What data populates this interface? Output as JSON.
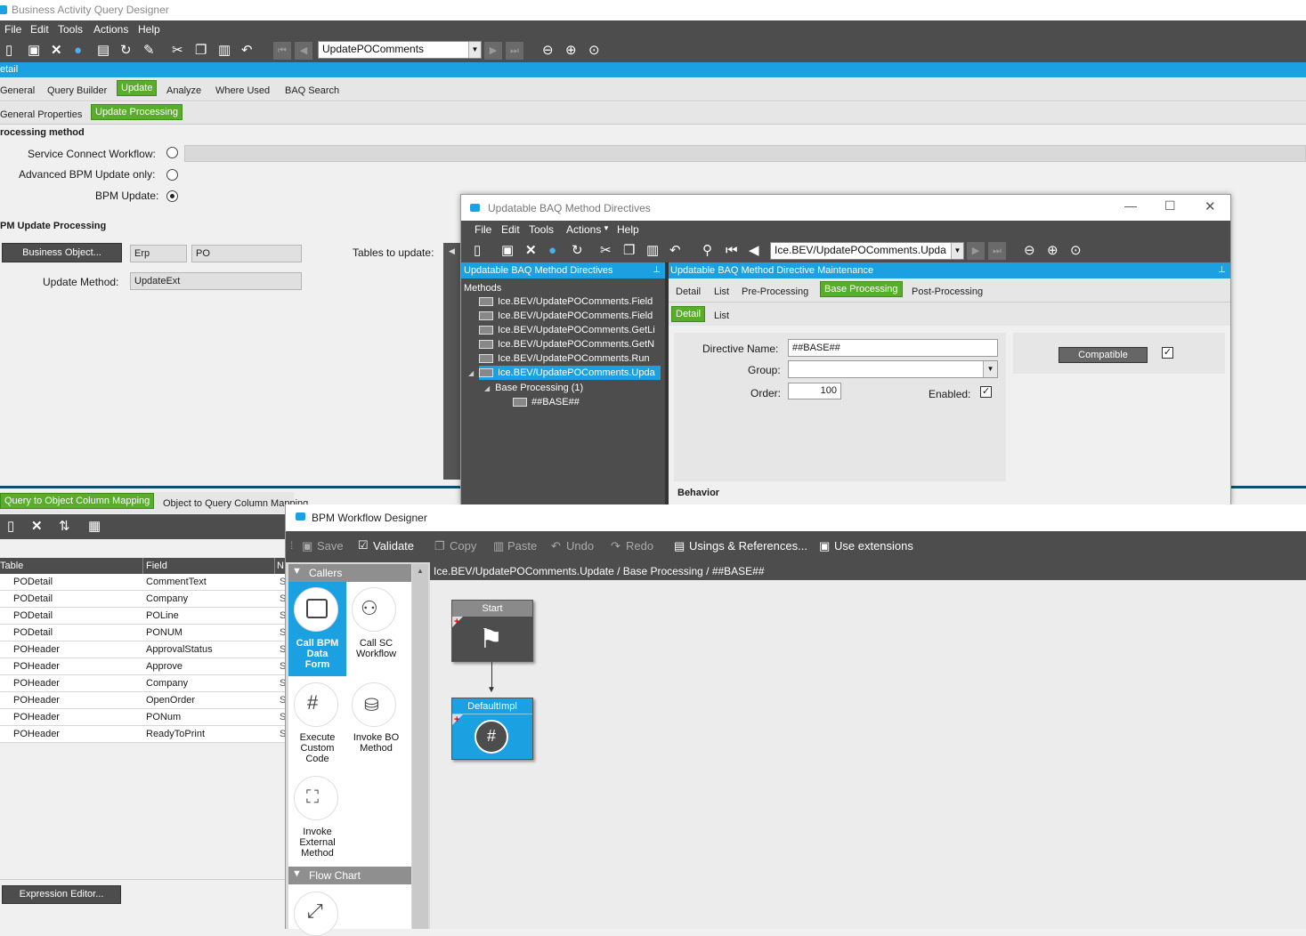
{
  "main": {
    "title": "Business Activity Query Designer",
    "menu": [
      "File",
      "Edit",
      "Tools",
      "Actions",
      "Help"
    ],
    "query_id": "UpdatePOComments",
    "detail_bar": "etail",
    "tabs1": [
      "General",
      "Query Builder",
      "Update",
      "Analyze",
      "Where Used",
      "BAQ Search"
    ],
    "tabs2": [
      "General Properties",
      "Update Processing"
    ],
    "processing_method": "rocessing method",
    "options": [
      "Service Connect Workflow:",
      "Advanced BPM Update only:",
      "BPM Update:"
    ],
    "bpm_section": "PM Update Processing",
    "business_object_btn": "Business Object...",
    "bo_fields": [
      "Erp",
      "PO"
    ],
    "tables_to_update": "Tables to update:",
    "update_method_label": "Update Method:",
    "update_method_value": "UpdateExt",
    "map_tabs": [
      "Query to Object Column Mapping",
      "Object to Query Column Mapping"
    ],
    "grid_headers": [
      "Table",
      "Field",
      "N"
    ],
    "grid_rows": [
      [
        "PODetail",
        "CommentText"
      ],
      [
        "PODetail",
        "Company"
      ],
      [
        "PODetail",
        "POLine"
      ],
      [
        "PODetail",
        "PONUM"
      ],
      [
        "POHeader",
        "ApprovalStatus"
      ],
      [
        "POHeader",
        "Approve"
      ],
      [
        "POHeader",
        "Company"
      ],
      [
        "POHeader",
        "OpenOrder"
      ],
      [
        "POHeader",
        "PONum"
      ],
      [
        "POHeader",
        "ReadyToPrint"
      ]
    ],
    "expression_editor": "Expression Editor..."
  },
  "directives": {
    "title": "Updatable BAQ Method Directives",
    "menu": [
      "File",
      "Edit",
      "Tools",
      "Actions",
      "Help"
    ],
    "combo": "Ice.BEV/UpdatePOComments.Upda",
    "left_header": "Updatable BAQ Method Directives",
    "right_header": "Updatable BAQ Method Directive Maintenance",
    "methods_label": "Methods",
    "methods": [
      "Ice.BEV/UpdatePOComments.Field",
      "Ice.BEV/UpdatePOComments.Field",
      "Ice.BEV/UpdatePOComments.GetLi",
      "Ice.BEV/UpdatePOComments.GetN",
      "Ice.BEV/UpdatePOComments.Run",
      "Ice.BEV/UpdatePOComments.Upda"
    ],
    "base_processing_node": "Base Processing (1)",
    "base_leaf": "##BASE##",
    "tabs": [
      "Detail",
      "List",
      "Pre-Processing",
      "Base Processing",
      "Post-Processing"
    ],
    "subtabs": [
      "Detail",
      "List"
    ],
    "directive_name_label": "Directive Name:",
    "directive_name": "##BASE##",
    "group_label": "Group:",
    "group_value": "",
    "order_label": "Order:",
    "order_value": "100",
    "enabled_label": "Enabled:",
    "compatible_btn": "Compatible",
    "behavior_label": "Behavior"
  },
  "workflow": {
    "title": "BPM Workflow Designer",
    "toolbar": [
      "Save",
      "Validate",
      "Copy",
      "Paste",
      "Undo",
      "Redo",
      "Usings & References...",
      "Use extensions"
    ],
    "callers_label": "Callers",
    "tools": [
      [
        "Call BPM",
        "Data",
        "Form"
      ],
      [
        "Call SC",
        "Workflow"
      ],
      [
        "Execute",
        "Custom",
        "Code"
      ],
      [
        "Invoke BO",
        "Method"
      ],
      [
        "Invoke",
        "External",
        "Method"
      ]
    ],
    "flowchart_label": "Flow Chart",
    "breadcrumb": "Ice.BEV/UpdatePOComments.Update / Base Processing / ##BASE##",
    "start_node": "Start",
    "impl_node": "DefaultImpl"
  },
  "colors": {
    "accent": "#1ba1e2",
    "green": "#58ad2b",
    "dark": "#4d4d4d"
  }
}
